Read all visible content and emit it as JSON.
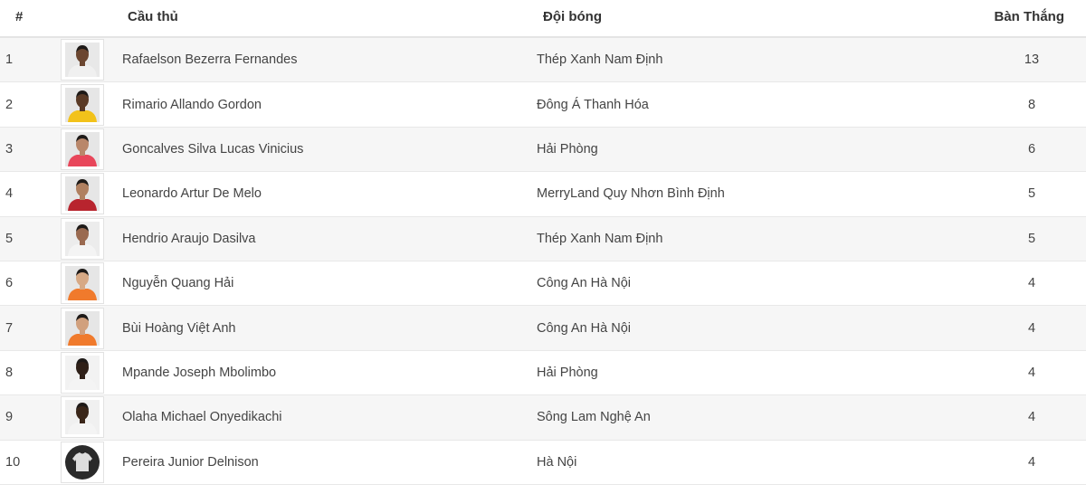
{
  "header": {
    "rank": "#",
    "player": "Cầu thủ",
    "team": "Đội bóng",
    "goals": "Bàn Thắng"
  },
  "rows": [
    {
      "rank": "1",
      "name": "Rafaelson Bezerra Fernandes",
      "team": "Thép Xanh Nam Định",
      "goals": "13",
      "skin": "#6b4630",
      "shirt": "#f0f0f0",
      "bg": "#e8e8e8"
    },
    {
      "rank": "2",
      "name": "Rimario Allando Gordon",
      "team": "Đông Á Thanh Hóa",
      "goals": "8",
      "skin": "#5a3a26",
      "shirt": "#f2c21a",
      "bg": "#e6e6e6"
    },
    {
      "rank": "3",
      "name": "Goncalves Silva Lucas Vinicius",
      "team": "Hải Phòng",
      "goals": "6",
      "skin": "#b9876a",
      "shirt": "#e8465a",
      "bg": "#e6e6e6"
    },
    {
      "rank": "4",
      "name": "Leonardo Artur De Melo",
      "team": "MerryLand Quy Nhơn Bình Định",
      "goals": "5",
      "skin": "#b08060",
      "shirt": "#b8242e",
      "bg": "#e6e6e6"
    },
    {
      "rank": "5",
      "name": "Hendrio Araujo Dasilva",
      "team": "Thép Xanh Nam Định",
      "goals": "5",
      "skin": "#9a6a50",
      "shirt": "#f4f4f4",
      "bg": "#ececec"
    },
    {
      "rank": "6",
      "name": "Nguyễn Quang Hải",
      "team": "Công An Hà Nội",
      "goals": "4",
      "skin": "#d7a985",
      "shirt": "#f07a2c",
      "bg": "#e6e6e6"
    },
    {
      "rank": "7",
      "name": "Bùi Hoàng Việt Anh",
      "team": "Công An Hà Nội",
      "goals": "4",
      "skin": "#d1a07d",
      "shirt": "#f07a2c",
      "bg": "#e6e6e6"
    },
    {
      "rank": "8",
      "name": "Mpande Joseph Mbolimbo",
      "team": "Hải Phòng",
      "goals": "4",
      "skin": "#2f2018",
      "shirt": "#f4f4f4",
      "bg": "#f2f2f2"
    },
    {
      "rank": "9",
      "name": "Olaha Michael Onyedikachi",
      "team": "Sông Lam Nghệ An",
      "goals": "4",
      "skin": "#3a2619",
      "shirt": "#f4f4f4",
      "bg": "#f0f0f0"
    },
    {
      "rank": "10",
      "name": "Pereira Junior Delnison",
      "team": "Hà Nội",
      "goals": "4",
      "skin": "#2a2a2a",
      "shirt": "#dddddd",
      "bg": "#2a2a2a",
      "placeholder": true
    }
  ]
}
